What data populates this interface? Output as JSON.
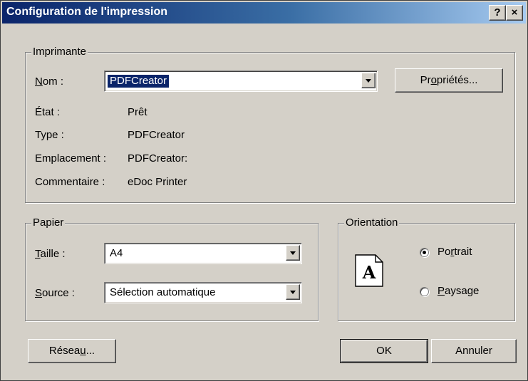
{
  "window": {
    "title": "Configuration de l'impression",
    "help_label": "?",
    "close_label": "×"
  },
  "printer": {
    "group_label": "Imprimante",
    "name_label_accel": "N",
    "name_label_rest": "om :",
    "name_value": "PDFCreator",
    "properties_pre": "Pr",
    "properties_accel": "o",
    "properties_post": "priétés...",
    "status_label": "État :",
    "status_value": "Prêt",
    "type_label": "Type :",
    "type_value": "PDFCreator",
    "location_label": "Emplacement :",
    "location_value": "PDFCreator:",
    "comment_label": "Commentaire :",
    "comment_value": "eDoc Printer"
  },
  "paper": {
    "group_label": "Papier",
    "size_label_accel": "T",
    "size_label_rest": "aille :",
    "size_value": "A4",
    "source_label_accel": "S",
    "source_label_rest": "ource :",
    "source_value": "Sélection automatique"
  },
  "orientation": {
    "group_label": "Orientation",
    "icon_letter": "A",
    "portrait_pre": "Po",
    "portrait_accel": "r",
    "portrait_post": "trait",
    "landscape_accel": "P",
    "landscape_post": "aysage",
    "selected": "portrait"
  },
  "buttons": {
    "network_pre": "Résea",
    "network_accel": "u",
    "network_post": "...",
    "ok": "OK",
    "cancel": "Annuler"
  }
}
